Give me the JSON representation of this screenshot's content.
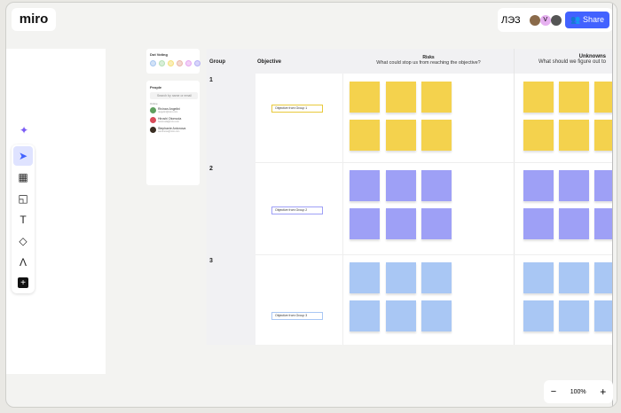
{
  "app": {
    "logo": "miro",
    "board_name": "ЛЭЗ",
    "share_label": "Share",
    "avatar_initial": "V"
  },
  "toolbar": {
    "tools": [
      {
        "name": "select",
        "glyph": "➤"
      },
      {
        "name": "templates",
        "glyph": "▦"
      },
      {
        "name": "sticky-note",
        "glyph": "◱"
      },
      {
        "name": "text",
        "glyph": "T"
      },
      {
        "name": "shapes",
        "glyph": "◇"
      },
      {
        "name": "pen",
        "glyph": "Λ"
      },
      {
        "name": "more",
        "glyph": "+"
      }
    ]
  },
  "dot_voting": {
    "title": "Dot Voting",
    "dots": [
      "#a9c8f0",
      "#b5e0b5",
      "#f5e07a",
      "#e8b5a8",
      "#e6a8f0",
      "#b5b0f5"
    ]
  },
  "people": {
    "title": "People",
    "search_placeholder": "Search by name or email",
    "section": "Online",
    "list": [
      {
        "name": "Rivinan Angelini",
        "email": "rangelini@miro.com",
        "color": "#5fa05f"
      },
      {
        "name": "Hiroshi Otomoda",
        "email": "hotomoda@miro.com",
        "color": "#d94c5a"
      },
      {
        "name": "Stephanie Antonova",
        "email": "santonova@miro.com",
        "color": "#3a2e22"
      }
    ]
  },
  "table": {
    "headers": {
      "group": "Group",
      "objective": "Objective",
      "risks_title": "Risks",
      "risks_sub": "What could stop us from reaching the objective?",
      "unknowns_title": "Unknowns",
      "unknowns_sub": "What should we figure out to"
    },
    "rows": [
      {
        "group": "1",
        "objective": "Objective from Group 1",
        "note_color": "#f4d24d",
        "border": "#e8c93c"
      },
      {
        "group": "2",
        "objective": "Objective from Group 2",
        "note_color": "#9ea0f6",
        "border": "#9ea0f6"
      },
      {
        "group": "3",
        "objective": "Objective from Group 3",
        "note_color": "#a9c7f4",
        "border": "#a9c7f4"
      }
    ]
  },
  "zoom": {
    "level": "100%",
    "minus": "−",
    "plus": "+"
  }
}
